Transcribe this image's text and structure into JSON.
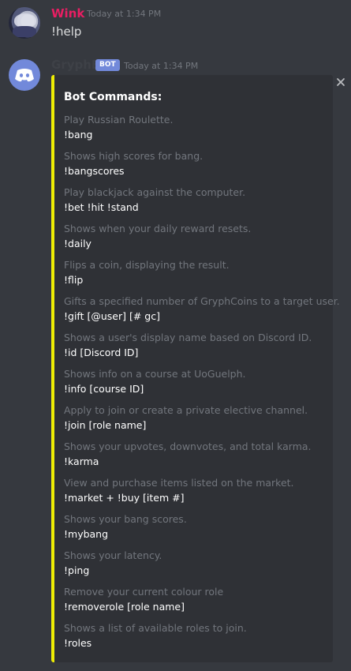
{
  "user_message": {
    "username": "Wink",
    "timestamp": "Today at 1:34 PM",
    "text": "!help"
  },
  "bot_message": {
    "username": "GryphBot",
    "badge": "BOT",
    "timestamp": "Today at 1:34 PM",
    "close_icon": "close-icon",
    "embed": {
      "accent_color": "#eded04",
      "title": "Bot Commands:",
      "commands": [
        {
          "description": "Play Russian Roulette.",
          "command": "!bang"
        },
        {
          "description": "Shows high scores for bang.",
          "command": "!bangscores"
        },
        {
          "description": "Play blackjack against the computer.",
          "command": "!bet !hit !stand"
        },
        {
          "description": "Shows when your daily reward resets.",
          "command": "!daily"
        },
        {
          "description": "Flips a coin, displaying the result.",
          "command": "!flip"
        },
        {
          "description": "Gifts a specified number of GryphCoins to a target user.",
          "command": "!gift [@user] [# gc]"
        },
        {
          "description": "Shows a user's display name based on Discord ID.",
          "command": "!id [Discord ID]"
        },
        {
          "description": "Shows info on a course at UoGuelph.",
          "command": "!info [course ID]"
        },
        {
          "description": "Apply to join or create a private elective channel.",
          "command": "!join [role name]"
        },
        {
          "description": "Shows your upvotes, downvotes, and total karma.",
          "command": "!karma"
        },
        {
          "description": "View and purchase items listed on the market.",
          "command": "!market + !buy [item #]"
        },
        {
          "description": "Shows your bang scores.",
          "command": "!mybang"
        },
        {
          "description": "Shows your latency.",
          "command": "!ping"
        },
        {
          "description": "Remove your current colour role",
          "command": "!removerole [role name]"
        },
        {
          "description": "Shows a list of available roles to join.",
          "command": "!roles"
        }
      ]
    }
  }
}
